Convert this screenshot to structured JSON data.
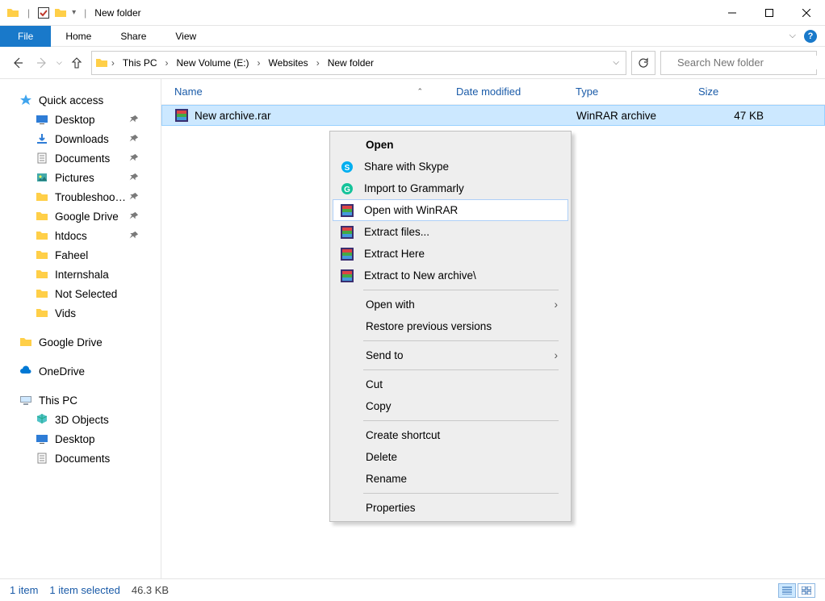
{
  "title": {
    "folder_name": "New folder"
  },
  "ribbon": {
    "file": "File",
    "tabs": [
      "Home",
      "Share",
      "View"
    ]
  },
  "breadcrumbs": [
    "This PC",
    "New Volume (E:)",
    "Websites",
    "New folder"
  ],
  "search": {
    "placeholder": "Search New folder"
  },
  "columns": {
    "name": "Name",
    "date": "Date modified",
    "type": "Type",
    "size": "Size"
  },
  "file": {
    "name": "New archive.rar",
    "date": "",
    "type": "WinRAR archive",
    "size": "47 KB"
  },
  "sidebar": {
    "quick_access": "Quick access",
    "quick_items": [
      "Desktop",
      "Downloads",
      "Documents",
      "Pictures",
      "Troubleshooting",
      "Google Drive",
      "htdocs",
      "Faheel",
      "Internshala",
      "Not Selected",
      "Vids"
    ],
    "pinned": [
      true,
      true,
      true,
      true,
      true,
      true,
      true,
      false,
      false,
      false,
      false
    ],
    "google_drive": "Google Drive",
    "onedrive": "OneDrive",
    "this_pc": "This PC",
    "pc_items": [
      "3D Objects",
      "Desktop",
      "Documents"
    ]
  },
  "context": {
    "open": "Open",
    "share_skype": "Share with Skype",
    "grammarly": "Import to Grammarly",
    "open_winrar": "Open with WinRAR",
    "extract_files": "Extract files...",
    "extract_here": "Extract Here",
    "extract_to": "Extract to New archive\\",
    "open_with": "Open with",
    "restore": "Restore previous versions",
    "send_to": "Send to",
    "cut": "Cut",
    "copy": "Copy",
    "shortcut": "Create shortcut",
    "delete": "Delete",
    "rename": "Rename",
    "properties": "Properties"
  },
  "status": {
    "count": "1 item",
    "selected": "1 item selected",
    "size": "46.3 KB"
  }
}
